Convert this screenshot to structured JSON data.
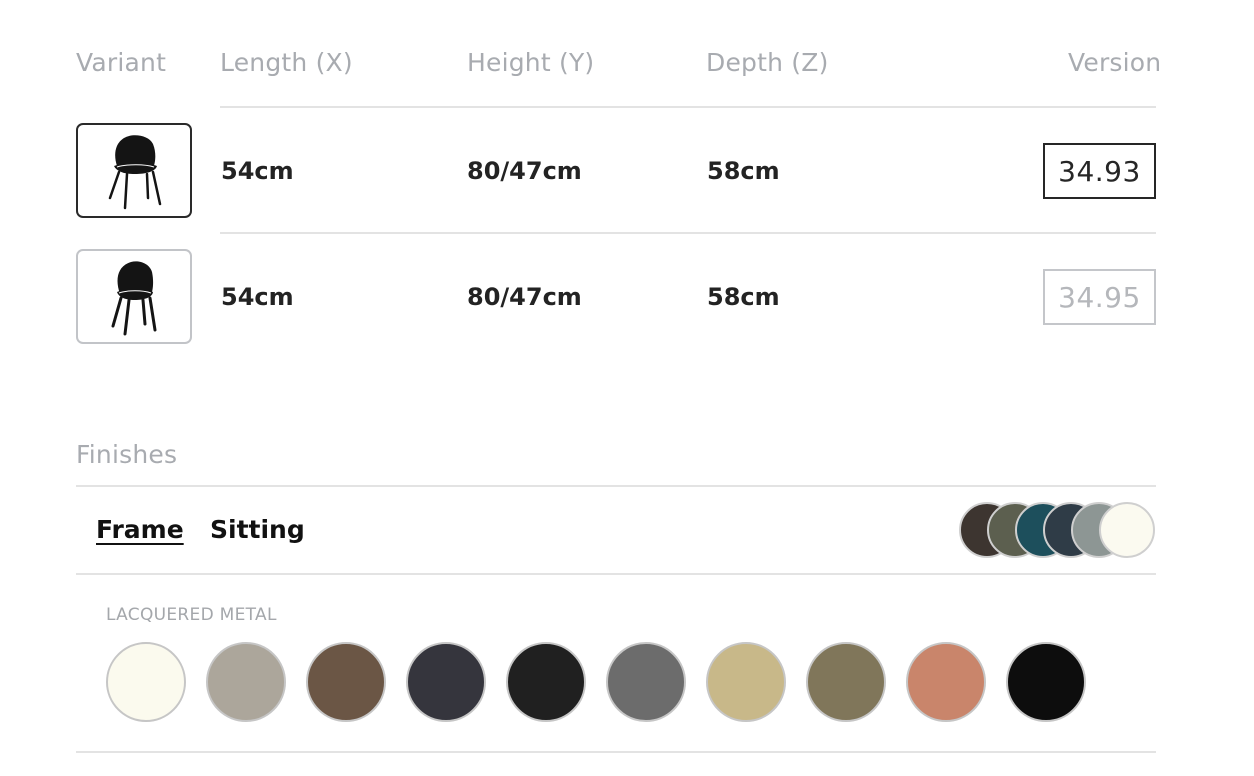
{
  "table": {
    "headers": {
      "variant": "Variant",
      "length": "Length (X)",
      "height": "Height (Y)",
      "depth": "Depth (Z)",
      "version": "Version"
    },
    "rows": [
      {
        "length": "54cm",
        "height": "80/47cm",
        "depth": "58cm",
        "version": "34.93",
        "selected": true,
        "icon": "chair-icon"
      },
      {
        "length": "54cm",
        "height": "80/47cm",
        "depth": "58cm",
        "version": "34.95",
        "selected": false,
        "icon": "chair-icon"
      }
    ]
  },
  "finishes": {
    "title": "Finishes",
    "tabs": [
      {
        "label": "Frame",
        "active": true
      },
      {
        "label": "Sitting",
        "active": false
      }
    ],
    "sitting_preview_colors": [
      "#3d3530",
      "#5c5f4f",
      "#1d4f5c",
      "#2f3c47",
      "#8d9694",
      "#fbfaf0"
    ],
    "group_label": "LACQUERED METAL",
    "swatches": [
      {
        "name": "white",
        "color": "#fbfaee"
      },
      {
        "name": "sand",
        "color": "#aca69b"
      },
      {
        "name": "bronze",
        "color": "#6b5645"
      },
      {
        "name": "anthracite",
        "color": "#35353d"
      },
      {
        "name": "black",
        "color": "#202020"
      },
      {
        "name": "grey",
        "color": "#6c6c6c"
      },
      {
        "name": "gold",
        "color": "#c8b889"
      },
      {
        "name": "olive-brass",
        "color": "#80765a"
      },
      {
        "name": "copper",
        "color": "#c9856b"
      },
      {
        "name": "glossy-black",
        "color": "#0d0d0d"
      }
    ]
  }
}
